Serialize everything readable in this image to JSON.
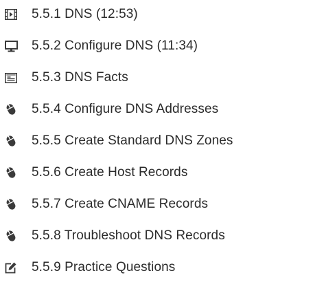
{
  "lessons": [
    {
      "label": "5.5.1 DNS (12:53)",
      "icon": "video-icon"
    },
    {
      "label": "5.5.2 Configure DNS (11:34)",
      "icon": "monitor-icon"
    },
    {
      "label": "5.5.3 DNS Facts",
      "icon": "text-document-icon"
    },
    {
      "label": "5.5.4 Configure DNS Addresses",
      "icon": "mouse-icon"
    },
    {
      "label": "5.5.5 Create Standard DNS Zones",
      "icon": "mouse-icon"
    },
    {
      "label": "5.5.6 Create Host Records",
      "icon": "mouse-icon"
    },
    {
      "label": "5.5.7 Create CNAME Records",
      "icon": "mouse-icon"
    },
    {
      "label": "5.5.8 Troubleshoot DNS Records",
      "icon": "mouse-icon"
    },
    {
      "label": "5.5.9 Practice Questions",
      "icon": "edit-icon"
    }
  ],
  "colors": {
    "text": "#2b2b2b",
    "icon": "#3a3a3a"
  }
}
